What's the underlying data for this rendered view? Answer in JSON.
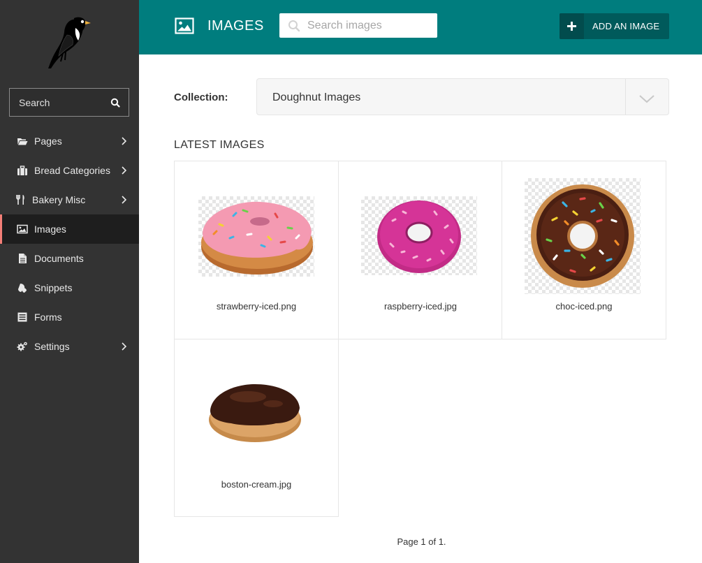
{
  "sidebar": {
    "search_placeholder": "Search",
    "items": [
      {
        "label": "Pages",
        "icon": "folder-open-icon",
        "has_submenu": true,
        "active": false
      },
      {
        "label": "Bread Categories",
        "icon": "suitcase-icon",
        "has_submenu": true,
        "active": false
      },
      {
        "label": "Bakery Misc",
        "icon": "cutlery-icon",
        "has_submenu": true,
        "active": false
      },
      {
        "label": "Images",
        "icon": "image-icon",
        "has_submenu": false,
        "active": true
      },
      {
        "label": "Documents",
        "icon": "document-icon",
        "has_submenu": false,
        "active": false
      },
      {
        "label": "Snippets",
        "icon": "snippet-icon",
        "has_submenu": false,
        "active": false
      },
      {
        "label": "Forms",
        "icon": "form-icon",
        "has_submenu": false,
        "active": false
      },
      {
        "label": "Settings",
        "icon": "cogs-icon",
        "has_submenu": true,
        "active": false
      }
    ]
  },
  "header": {
    "title": "IMAGES",
    "search_placeholder": "Search images",
    "add_button_label": "ADD AN IMAGE"
  },
  "collection": {
    "label": "Collection:",
    "selected": "Doughnut Images"
  },
  "latest_heading": "LATEST IMAGES",
  "images": [
    {
      "filename": "strawberry-iced.png",
      "transparent_bg": true
    },
    {
      "filename": "raspberry-iced.jpg",
      "transparent_bg": true
    },
    {
      "filename": "choc-iced.png",
      "transparent_bg": true
    },
    {
      "filename": "boston-cream.jpg",
      "transparent_bg": false
    }
  ],
  "pagination": "Page 1 of 1.",
  "colors": {
    "sidebar_bg": "#333333",
    "header_bg": "#007d7e",
    "add_button_bg": "#005a5b",
    "active_indicator": "#f37e77"
  }
}
